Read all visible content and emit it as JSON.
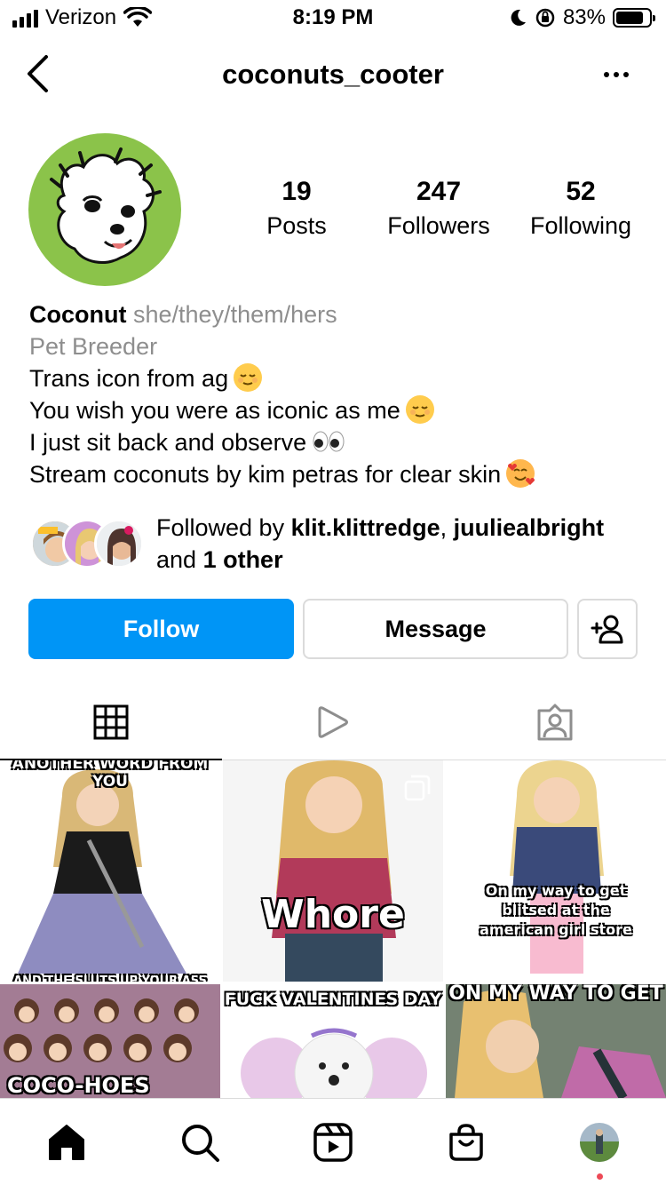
{
  "status_bar": {
    "carrier": "Verizon",
    "time": "8:19 PM",
    "battery_percent": "83%",
    "battery_level": 0.83,
    "icons": [
      "signal-icon",
      "wifi-icon",
      "moon-icon",
      "orientation-lock-icon",
      "battery-icon"
    ]
  },
  "header": {
    "username": "coconuts_cooter",
    "back_icon": "chevron-left-icon",
    "more_icon": "more-horizontal-icon"
  },
  "profile": {
    "stats": [
      {
        "count": "19",
        "label": "Posts"
      },
      {
        "count": "247",
        "label": "Followers"
      },
      {
        "count": "52",
        "label": "Following"
      }
    ],
    "name": "Coconut",
    "pronouns": "she/they/them/hers",
    "category": "Pet Breeder",
    "bio_lines": [
      {
        "text": "Trans icon from ag",
        "emoji": "relieved-face-emoji"
      },
      {
        "text": "You wish you were as iconic as me",
        "emoji": "relieved-face-emoji"
      },
      {
        "text": "I just sit back and observe",
        "emoji": "eyes-emoji"
      },
      {
        "text": "Stream coconuts by kim petras for clear skin",
        "emoji": "smiling-face-with-hearts-emoji"
      }
    ],
    "followed_by": {
      "prefix": "Followed by ",
      "user1": "klit.klittredge",
      "sep": ", ",
      "user2": "juuliealbright",
      "and": "and ",
      "other": "1 other"
    }
  },
  "actions": {
    "follow": "Follow",
    "message": "Message",
    "add_user_icon": "add-person-icon"
  },
  "tabs": [
    {
      "name": "grid-icon",
      "active": true
    },
    {
      "name": "reels-play-icon",
      "active": false
    },
    {
      "name": "tagged-person-icon",
      "active": false
    }
  ],
  "posts": [
    {
      "caption_top": "ANOTHER WORD FROM YOU",
      "caption_bottom": "AND THE SLUTS UP YOUR ASS BITCH"
    },
    {
      "caption": "Whore",
      "multiple": true
    },
    {
      "caption": "On my way to get blitsed at the american girl store"
    },
    {
      "caption": "COCO-HOES STRO"
    },
    {
      "caption": "FUCK VALENTINES DAY"
    },
    {
      "caption": "ON MY WAY TO GET"
    }
  ],
  "bottom_nav": [
    {
      "name": "home-icon"
    },
    {
      "name": "search-icon"
    },
    {
      "name": "reels-icon"
    },
    {
      "name": "shop-icon"
    },
    {
      "name": "profile-avatar"
    }
  ],
  "colors": {
    "follow_blue": "#0095f6",
    "avatar_green": "#8bc34a",
    "secondary_text": "#8e8e8e",
    "notification_red": "#ed4956"
  }
}
